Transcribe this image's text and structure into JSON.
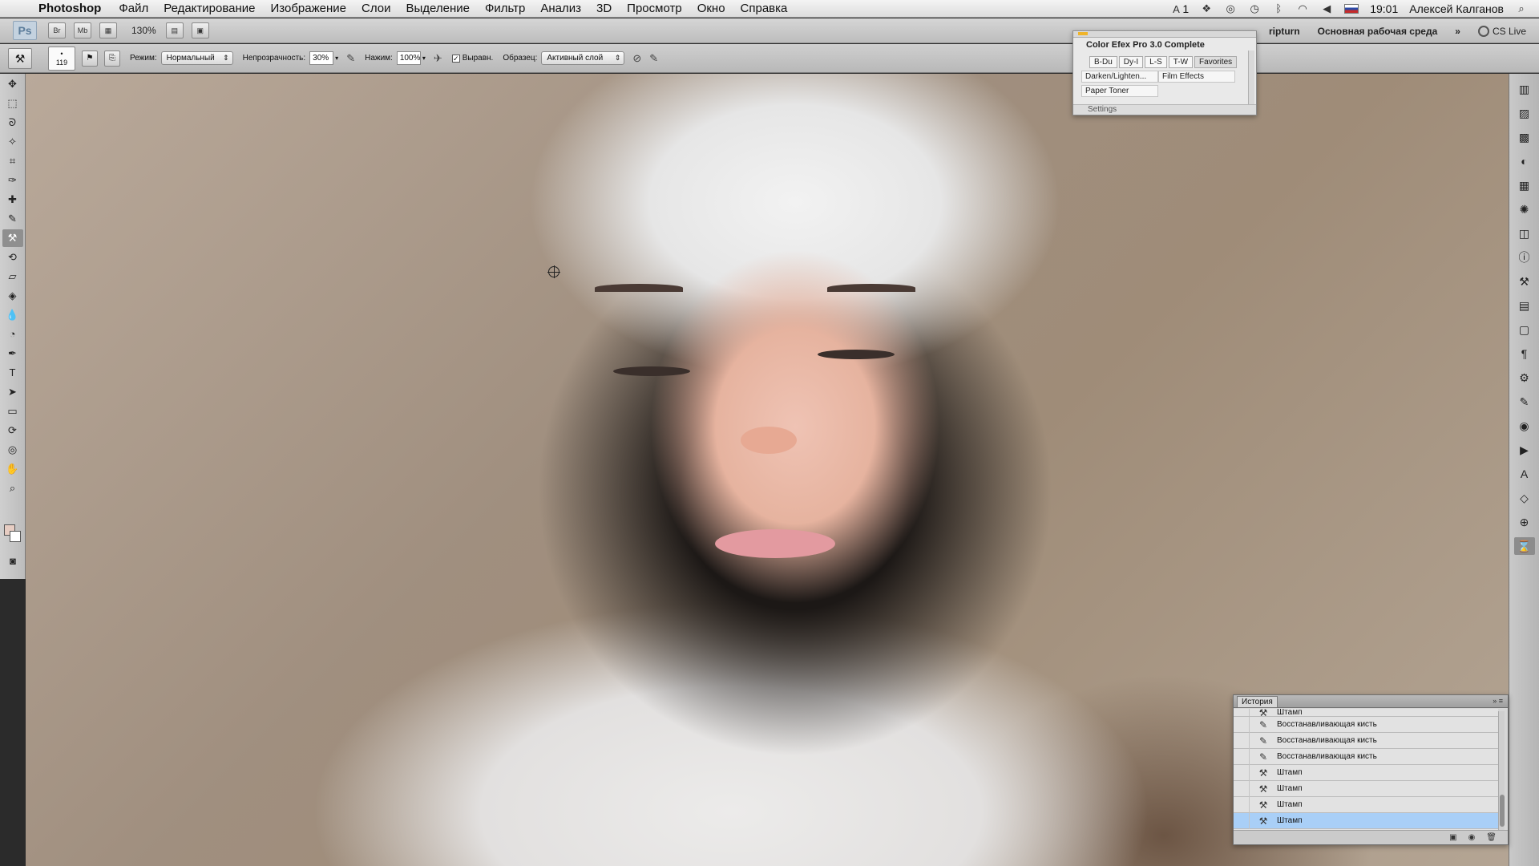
{
  "menubar": {
    "app_name": "Photoshop",
    "items": [
      "Файл",
      "Редактирование",
      "Изображение",
      "Слои",
      "Выделение",
      "Фильтр",
      "Анализ",
      "3D",
      "Просмотр",
      "Окно",
      "Справка"
    ],
    "right": {
      "adobe_count": "1",
      "time": "19:01",
      "user": "Алексей Калганов"
    }
  },
  "appbar": {
    "logo": "Ps",
    "br_label": "Br",
    "mb_label": "Mb",
    "zoom": "130%",
    "script_label": "ripturn",
    "workspace": "Основная рабочая среда",
    "overflow": "»",
    "cs_live": "CS Live"
  },
  "optbar": {
    "brush_size": "119",
    "mode_label": "Режим:",
    "mode_value": "Нормальный",
    "opacity_label": "Непрозрачность:",
    "opacity_value": "30%",
    "flow_label": "Нажим:",
    "flow_value": "100%",
    "aligned_label": "Выравн.",
    "sample_label": "Образец:",
    "sample_value": "Активный слой"
  },
  "efex": {
    "title": "Color Efex Pro 3.0 Complete",
    "tabs": [
      "B-Du",
      "Dy-I",
      "L-S",
      "T-W",
      "Favorites"
    ],
    "active_tab": "Favorites",
    "filters": [
      "Darken/Lighten...",
      "Film Effects",
      "Paper Toner"
    ],
    "settings": "Settings"
  },
  "history": {
    "title": "История",
    "partial_item": "Штамп",
    "items": [
      {
        "label": "Восстанавливающая кисть",
        "icon": "healing-brush-icon"
      },
      {
        "label": "Восстанавливающая кисть",
        "icon": "healing-brush-icon"
      },
      {
        "label": "Восстанавливающая кисть",
        "icon": "healing-brush-icon"
      },
      {
        "label": "Штамп",
        "icon": "clone-stamp-icon"
      },
      {
        "label": "Штамп",
        "icon": "clone-stamp-icon"
      },
      {
        "label": "Штамп",
        "icon": "clone-stamp-icon"
      },
      {
        "label": "Штамп",
        "icon": "clone-stamp-icon"
      }
    ],
    "selected_index": 6
  },
  "colors": {
    "selection": "#a9cff7",
    "foreground_swatch": "#e7cdc3",
    "background_swatch": "#ffffff"
  }
}
